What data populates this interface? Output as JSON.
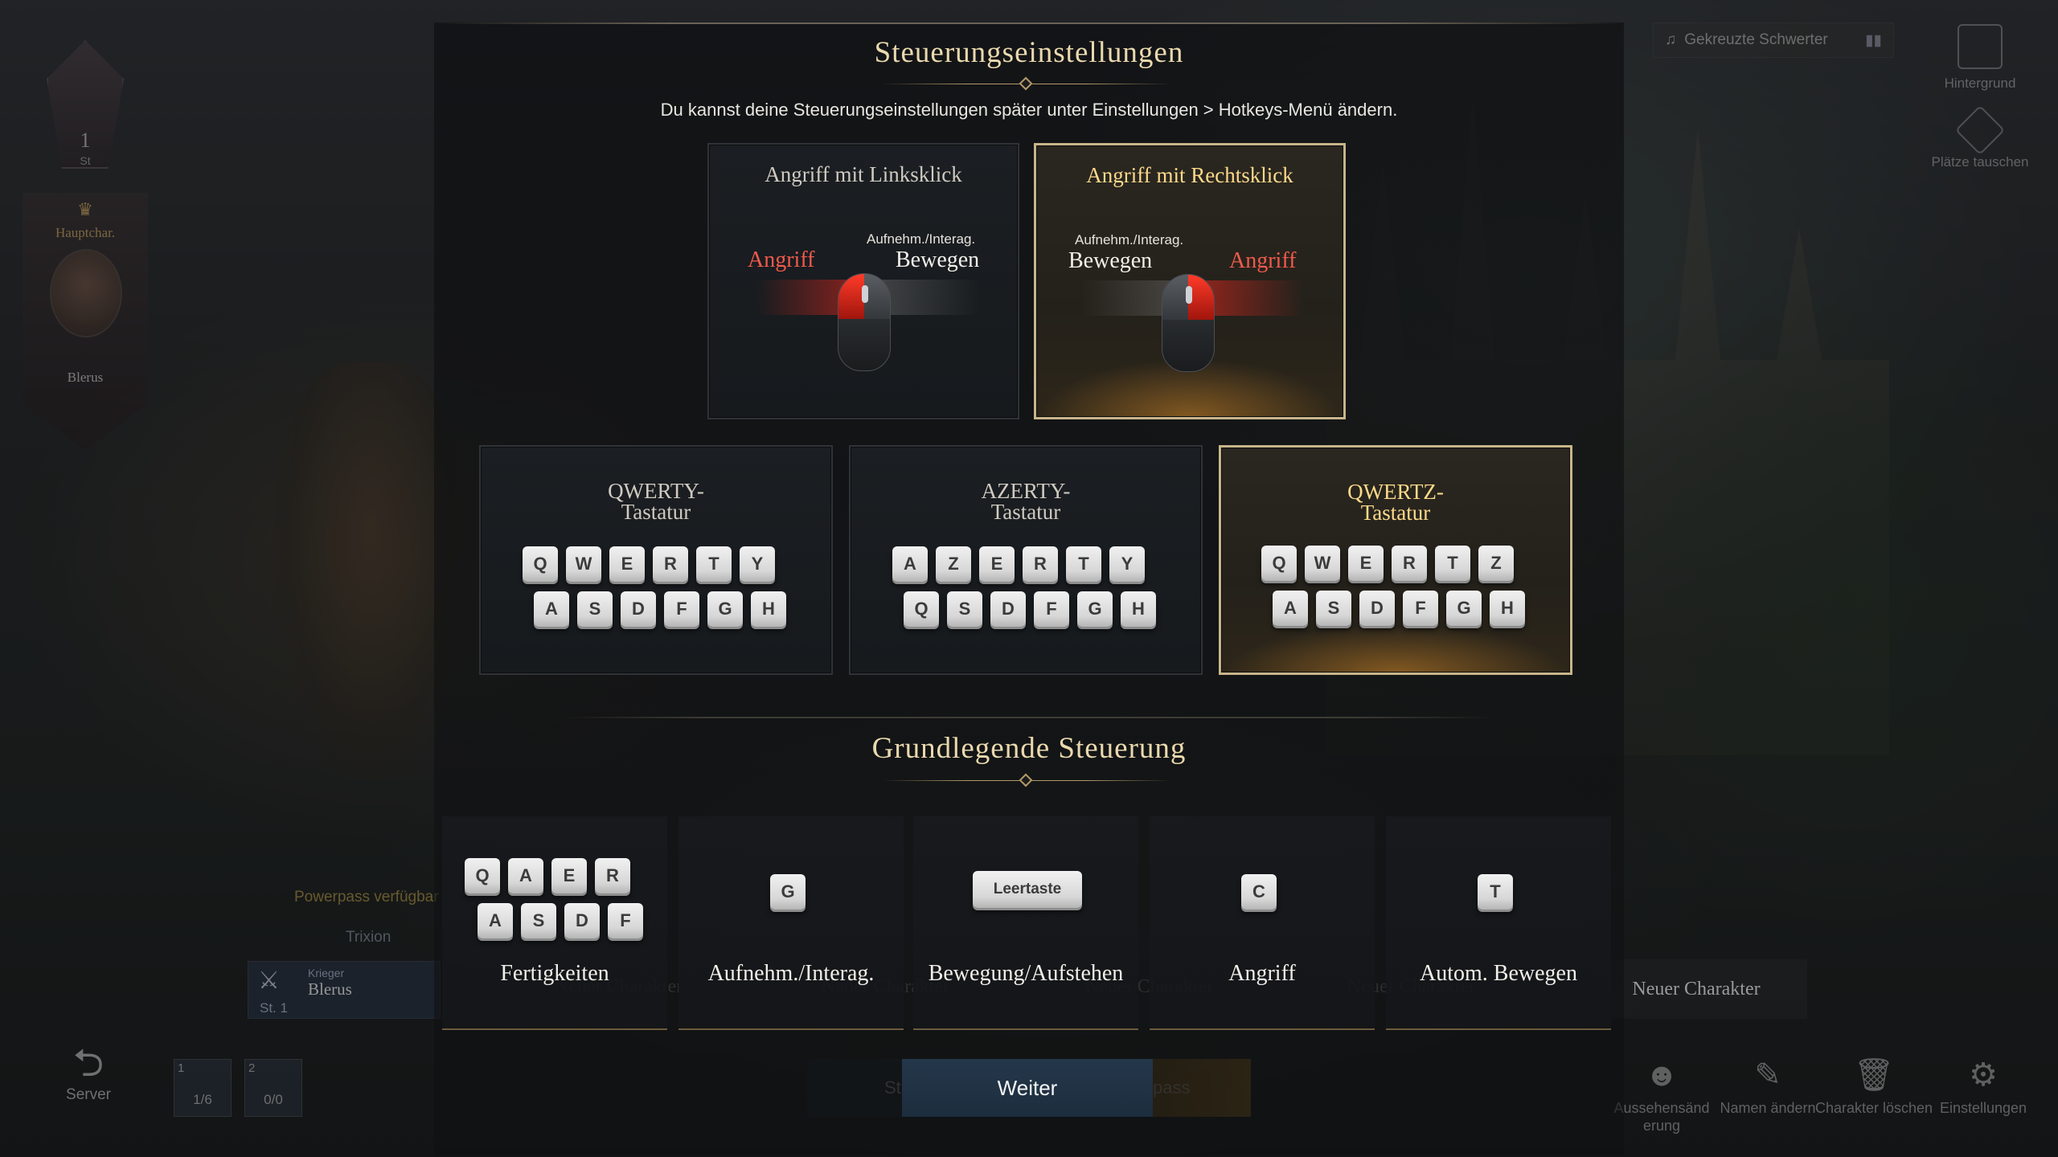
{
  "background": {
    "server_level": "1",
    "server_level_suffix": "St",
    "main_char_title": "Hauptchar.",
    "main_char_name": "Blerus",
    "music_title": "Gekreuzte Schwerter",
    "top_right_items": [
      "Hintergrund",
      "Plätze tauschen"
    ],
    "powerpass_text": "Powerpass verfügbar",
    "server_name": "Trixion",
    "char_card": {
      "class": "Krieger",
      "name": "Blerus",
      "level": "St. 1"
    },
    "new_character_label": "Neuer Charakter",
    "server_button": "Server",
    "slots": [
      {
        "index": "1",
        "count": "1/6"
      },
      {
        "index": "2",
        "count": "0/0"
      }
    ],
    "start_partial": "St",
    "pass_partial": "pass",
    "bottom_right": [
      "Aussehensänd erung",
      "Namen ändern",
      "Charakter löschen",
      "Einstellungen"
    ]
  },
  "dialog": {
    "title": "Steuerungseinstellungen",
    "subtitle": "Du kannst deine Steuerungseinstellungen später unter Einstellungen > Hotkeys-Menü ändern.",
    "mouse_options": [
      {
        "title": "Angriff mit Linksklick",
        "selected": false,
        "left_label": "Angriff",
        "right_small": "Aufnehm./Interag.",
        "right_label": "Bewegen"
      },
      {
        "title": "Angriff mit Rechtsklick",
        "selected": true,
        "left_small": "Aufnehm./Interag.",
        "left_label": "Bewegen",
        "right_label": "Angriff"
      }
    ],
    "keyboard_options": [
      {
        "title_line1": "QWERTY-",
        "title_line2": "Tastatur",
        "selected": false,
        "row1": [
          "Q",
          "W",
          "E",
          "R",
          "T",
          "Y"
        ],
        "row2": [
          "A",
          "S",
          "D",
          "F",
          "G",
          "H"
        ]
      },
      {
        "title_line1": "AZERTY-",
        "title_line2": "Tastatur",
        "selected": false,
        "row1": [
          "A",
          "Z",
          "E",
          "R",
          "T",
          "Y"
        ],
        "row2": [
          "Q",
          "S",
          "D",
          "F",
          "G",
          "H"
        ]
      },
      {
        "title_line1": "QWERTZ-",
        "title_line2": "Tastatur",
        "selected": true,
        "row1": [
          "Q",
          "W",
          "E",
          "R",
          "T",
          "Z"
        ],
        "row2": [
          "A",
          "S",
          "D",
          "F",
          "G",
          "H"
        ]
      }
    ],
    "basic_title": "Grundlegende Steuerung",
    "basic_controls": [
      {
        "keys_row1": [
          "Q",
          "A",
          "E",
          "R"
        ],
        "keys_row2": [
          "A",
          "S",
          "D",
          "F"
        ],
        "label": "Fertigkeiten"
      },
      {
        "key": "G",
        "label": "Aufnehm./Interag."
      },
      {
        "key": "Leertaste",
        "label": "Bewegung/Aufstehen"
      },
      {
        "key": "C",
        "label": "Angriff"
      },
      {
        "key": "T",
        "label": "Autom. Bewegen"
      }
    ],
    "continue_button": "Weiter"
  },
  "colors": {
    "accent_gold": "#ead9ae",
    "attack_red": "#f05a4c",
    "selected_border": "#c8b58a",
    "button_blue": "#24374a"
  }
}
